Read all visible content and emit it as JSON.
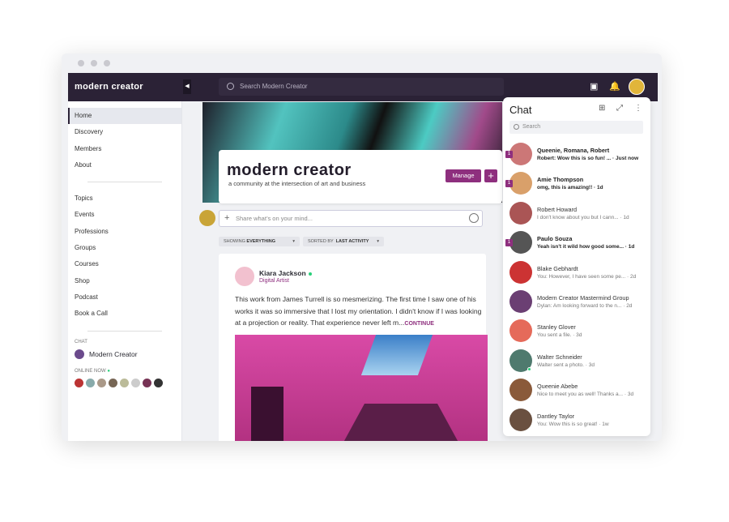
{
  "header": {
    "logo": "modern creator",
    "search_placeholder": "Search Modern Creator"
  },
  "sidebar": {
    "primary": [
      "Home",
      "Discovery",
      "Members",
      "About"
    ],
    "secondary": [
      "Topics",
      "Events",
      "Professions",
      "Groups",
      "Courses",
      "Shop",
      "Podcast",
      "Book a Call"
    ],
    "chat_label": "CHAT",
    "chat_item": "Modern Creator",
    "online_label": "ONLINE NOW",
    "online_colors": [
      "#b33",
      "#8aa",
      "#a98",
      "#765",
      "#bb9",
      "#ccc",
      "#735",
      "#333"
    ],
    "active": "Home"
  },
  "community": {
    "title": "modern creator",
    "subtitle": "a community at the intersection of art and business",
    "manage": "Manage",
    "add": "+"
  },
  "composer": {
    "placeholder": "Share what’s on your mind..."
  },
  "filters": {
    "showing_label": "SHOWING",
    "showing_value": "EVERYTHING",
    "sorted_label": "SORTED BY",
    "sorted_value": "LAST ACTIVITY"
  },
  "post": {
    "author": "Kiara Jackson",
    "role": "Digital Artist",
    "text": "This work from James Turrell is so mesmerizing. The first time I saw one of his works it was so immersive that I lost my orientation. I didn't know if I was looking at a projection or reality. That experience never left m...",
    "more": "CONTINUE"
  },
  "chat": {
    "title": "Chat",
    "search_placeholder": "Search",
    "items": [
      {
        "name": "Queenie, Romana, Robert",
        "msg": "Robert: Wow this is so fun! ... · Just now",
        "badge": "1",
        "unread": true,
        "color": "#c77"
      },
      {
        "name": "Amie Thompson",
        "msg": "omg, this is amazing!! · 1d",
        "badge": "1",
        "unread": true,
        "color": "#d9a06a"
      },
      {
        "name": "Robert Howard",
        "msg": "I don't know about you but I cann... · 1d",
        "unread": false,
        "color": "#a55"
      },
      {
        "name": "Paulo Souza",
        "msg": "Yeah isn't it wild how good some... · 1d",
        "badge": "1",
        "unread": true,
        "color": "#555"
      },
      {
        "name": "Blake Gebhardt",
        "msg": "You: However, I have seen some pe... · 2d",
        "unread": false,
        "color": "#c33"
      },
      {
        "name": "Modern Creator Mastermind Group",
        "msg": "Dylan: Am looking forward to the n... · 2d",
        "unread": false,
        "color": "#6b3f73"
      },
      {
        "name": "Stanley Glover",
        "msg": "You sent a file. · 3d",
        "unread": false,
        "color": "#e56a5a"
      },
      {
        "name": "Walter Schneider",
        "msg": "Walter sent a photo. · 3d",
        "unread": false,
        "color": "#4f7a6e",
        "online": true
      },
      {
        "name": "Queenie Abebe",
        "msg": "Nice to meet you as well! Thanks a... · 3d",
        "unread": false,
        "color": "#8a5a3a"
      },
      {
        "name": "Dantley Taylor",
        "msg": "You: Wow this is so great! · 1w",
        "unread": false,
        "color": "#6a5040"
      }
    ]
  }
}
